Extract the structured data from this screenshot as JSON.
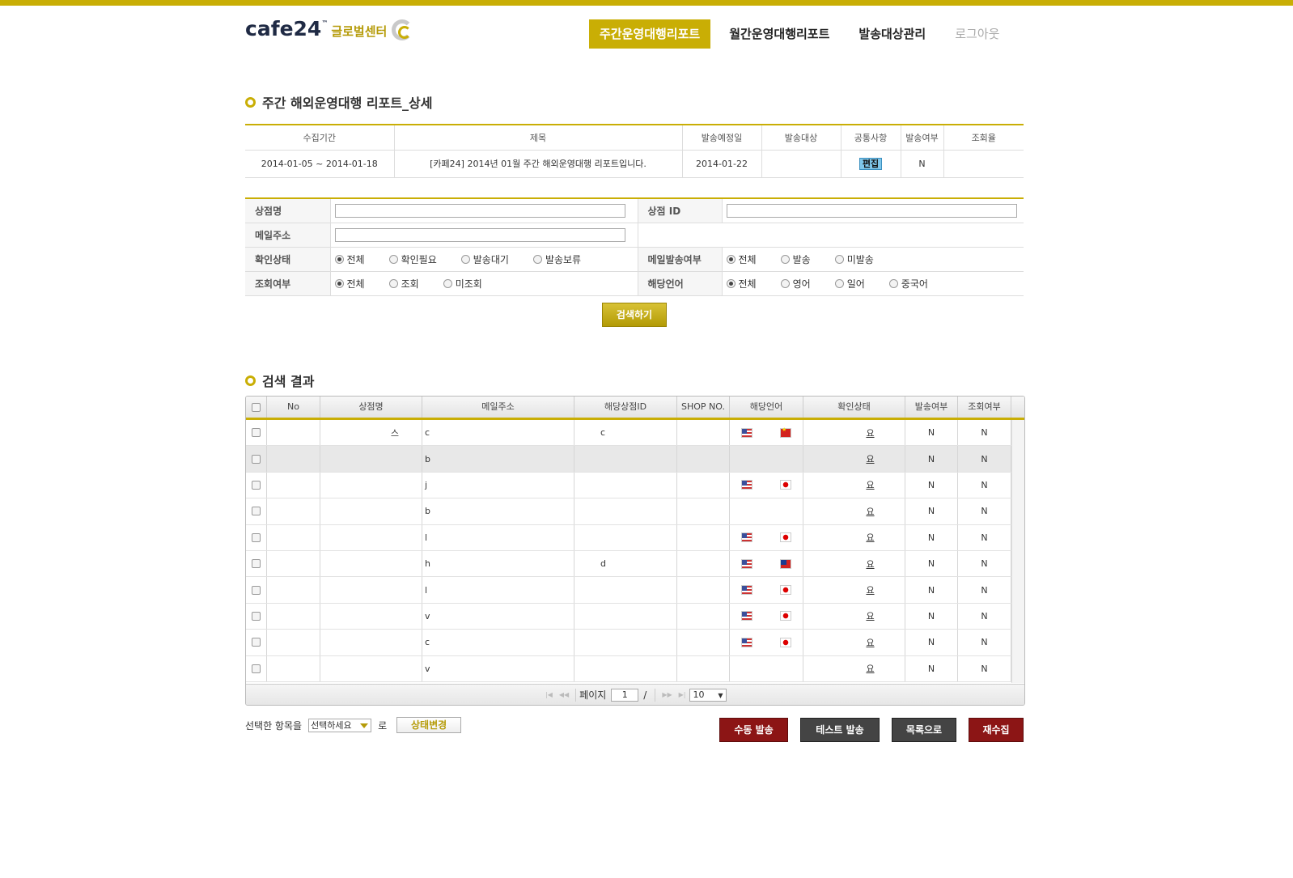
{
  "header": {
    "logo_word": "cafe24",
    "logo_tm": "™",
    "logo_sub": "글로벌센터",
    "nav": [
      {
        "label": "주간운영대행리포트"
      },
      {
        "label": "월간운영대행리포트"
      },
      {
        "label": "발송대상관리"
      },
      {
        "label": "로그아웃"
      }
    ]
  },
  "report": {
    "title": "주간 해외운영대행 리포트_상세",
    "columns": [
      "수집기간",
      "제목",
      "발송예정일",
      "발송대상",
      "공통사항",
      "발송여부",
      "조회율"
    ],
    "row": {
      "period": "2014-01-05 ~ 2014-01-18",
      "subject": "[카페24] 2014년 01월 주간 해외운영대행 리포트입니다.",
      "send_date": "2014-01-22",
      "target": "",
      "common": "편집",
      "sent": "N",
      "view_rate": ""
    }
  },
  "search": {
    "shop_name_label": "상점명",
    "shop_id_label": "상점 ID",
    "email_label": "메일주소",
    "confirm_label": "확인상태",
    "confirm_options": [
      "전체",
      "확인필요",
      "발송대기",
      "발송보류"
    ],
    "mail_send_label": "메일발송여부",
    "mail_send_options": [
      "전체",
      "발송",
      "미발송"
    ],
    "view_label": "조회여부",
    "view_options": [
      "전체",
      "조회",
      "미조회"
    ],
    "lang_label": "해당언어",
    "lang_options": [
      "전체",
      "영어",
      "일어",
      "중국어"
    ],
    "button": "검색하기"
  },
  "results": {
    "title": "검색 결과",
    "columns": [
      "No",
      "상점명",
      "메일주소",
      "해당상점ID",
      "SHOP NO.",
      "해당언어",
      "확인상태",
      "발송여부",
      "조회여부"
    ],
    "rows": [
      {
        "shop": "스",
        "email": "c",
        "shop_id": "c",
        "shop_no": "",
        "flags": [
          "us",
          "cn"
        ],
        "status": "요",
        "sent": "N",
        "viewed": "N"
      },
      {
        "shop": "",
        "email": "b",
        "shop_id": "",
        "shop_no": "",
        "flags": [],
        "status": "요",
        "sent": "N",
        "viewed": "N"
      },
      {
        "shop": "",
        "email": "j",
        "shop_id": "",
        "shop_no": "",
        "flags": [
          "us",
          "jp"
        ],
        "status": "요",
        "sent": "N",
        "viewed": "N"
      },
      {
        "shop": "",
        "email": "b",
        "shop_id": "",
        "shop_no": "",
        "flags": [],
        "status": "요",
        "sent": "N",
        "viewed": "N"
      },
      {
        "shop": "",
        "email": "l",
        "shop_id": "",
        "shop_no": "",
        "flags": [
          "us",
          "jp"
        ],
        "status": "요",
        "sent": "N",
        "viewed": "N"
      },
      {
        "shop": "",
        "email": "h",
        "shop_id": "d",
        "shop_no": "",
        "flags": [
          "us",
          "tw"
        ],
        "status": "요",
        "sent": "N",
        "viewed": "N"
      },
      {
        "shop": "",
        "email": "l",
        "shop_id": "",
        "shop_no": "",
        "flags": [
          "us",
          "jp"
        ],
        "status": "요",
        "sent": "N",
        "viewed": "N"
      },
      {
        "shop": "",
        "email": "v",
        "shop_id": "",
        "shop_no": "",
        "flags": [
          "us",
          "jp"
        ],
        "status": "요",
        "sent": "N",
        "viewed": "N"
      },
      {
        "shop": "",
        "email": "c",
        "shop_id": "",
        "shop_no": "",
        "flags": [
          "us",
          "jp"
        ],
        "status": "요",
        "sent": "N",
        "viewed": "N"
      },
      {
        "shop": "",
        "email": "v",
        "shop_id": "",
        "shop_no": "",
        "flags": [],
        "status": "요",
        "sent": "N",
        "viewed": "N"
      }
    ],
    "pager": {
      "page_label": "페이지",
      "page": "1",
      "slash": "/",
      "page_size": "10"
    }
  },
  "actions": {
    "selected_label": "선택한 항목을",
    "select_placeholder": "선택하세요",
    "ro": "로",
    "status_change": "상태변경",
    "manual_send": "수동 발송",
    "test_send": "테스트 발송",
    "to_list": "목록으로",
    "recollect": "재수집"
  },
  "colors": {
    "accent": "#c9ae05",
    "danger": "#8c1515",
    "dark": "#444444"
  }
}
